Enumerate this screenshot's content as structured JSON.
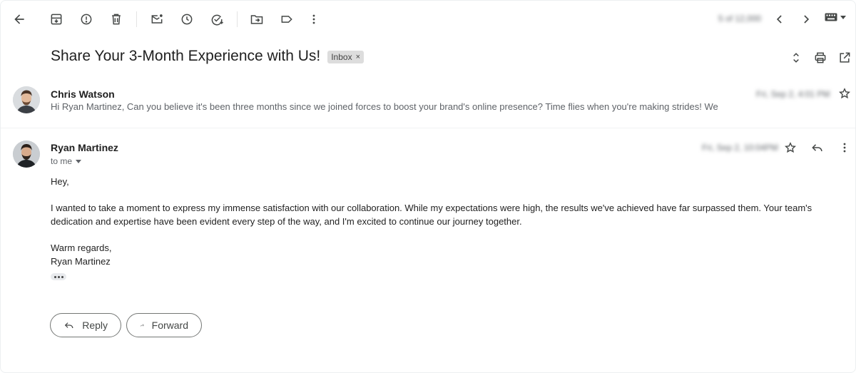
{
  "toolbar": {
    "pager_text": "5 of 12,000"
  },
  "subject": {
    "title": "Share Your 3-Month Experience with Us!",
    "label": "Inbox",
    "label_remove": "×"
  },
  "collapsed_message": {
    "sender": "Chris Watson",
    "date": "Fri, Sep 2, 4:01 PM",
    "snippet": "Hi Ryan Martinez, Can you believe it's been three months since we joined forces to boost your brand's online presence? Time flies when you're making strides! We"
  },
  "open_message": {
    "sender": "Ryan Martinez",
    "date": "Fri, Sep 2, 10:04PM",
    "to": "to me",
    "body": {
      "greeting": "Hey,",
      "paragraph": "I wanted to take a moment to express my immense satisfaction with our collaboration. While my expectations were high, the results we've achieved have far surpassed them. Your team's dedication and expertise have been evident every step of the way, and I'm excited to continue our journey together.",
      "closing": "Warm regards,",
      "signature": "Ryan Martinez"
    }
  },
  "actions": {
    "reply_label": "Reply",
    "forward_label": "Forward"
  },
  "icons": [
    "back-arrow-icon",
    "archive-icon",
    "report-spam-icon",
    "delete-icon",
    "mark-unread-icon",
    "snooze-icon",
    "add-task-icon",
    "move-to-icon",
    "label-icon",
    "more-vert-icon",
    "chevron-left-icon",
    "chevron-right-icon",
    "keyboard-icon",
    "expand-collapse-icon",
    "print-icon",
    "open-new-window-icon",
    "star-icon",
    "reply-icon"
  ],
  "colors": {
    "icon": "#444746",
    "muted_text": "#5f6368",
    "label_bg": "#dddddd"
  }
}
